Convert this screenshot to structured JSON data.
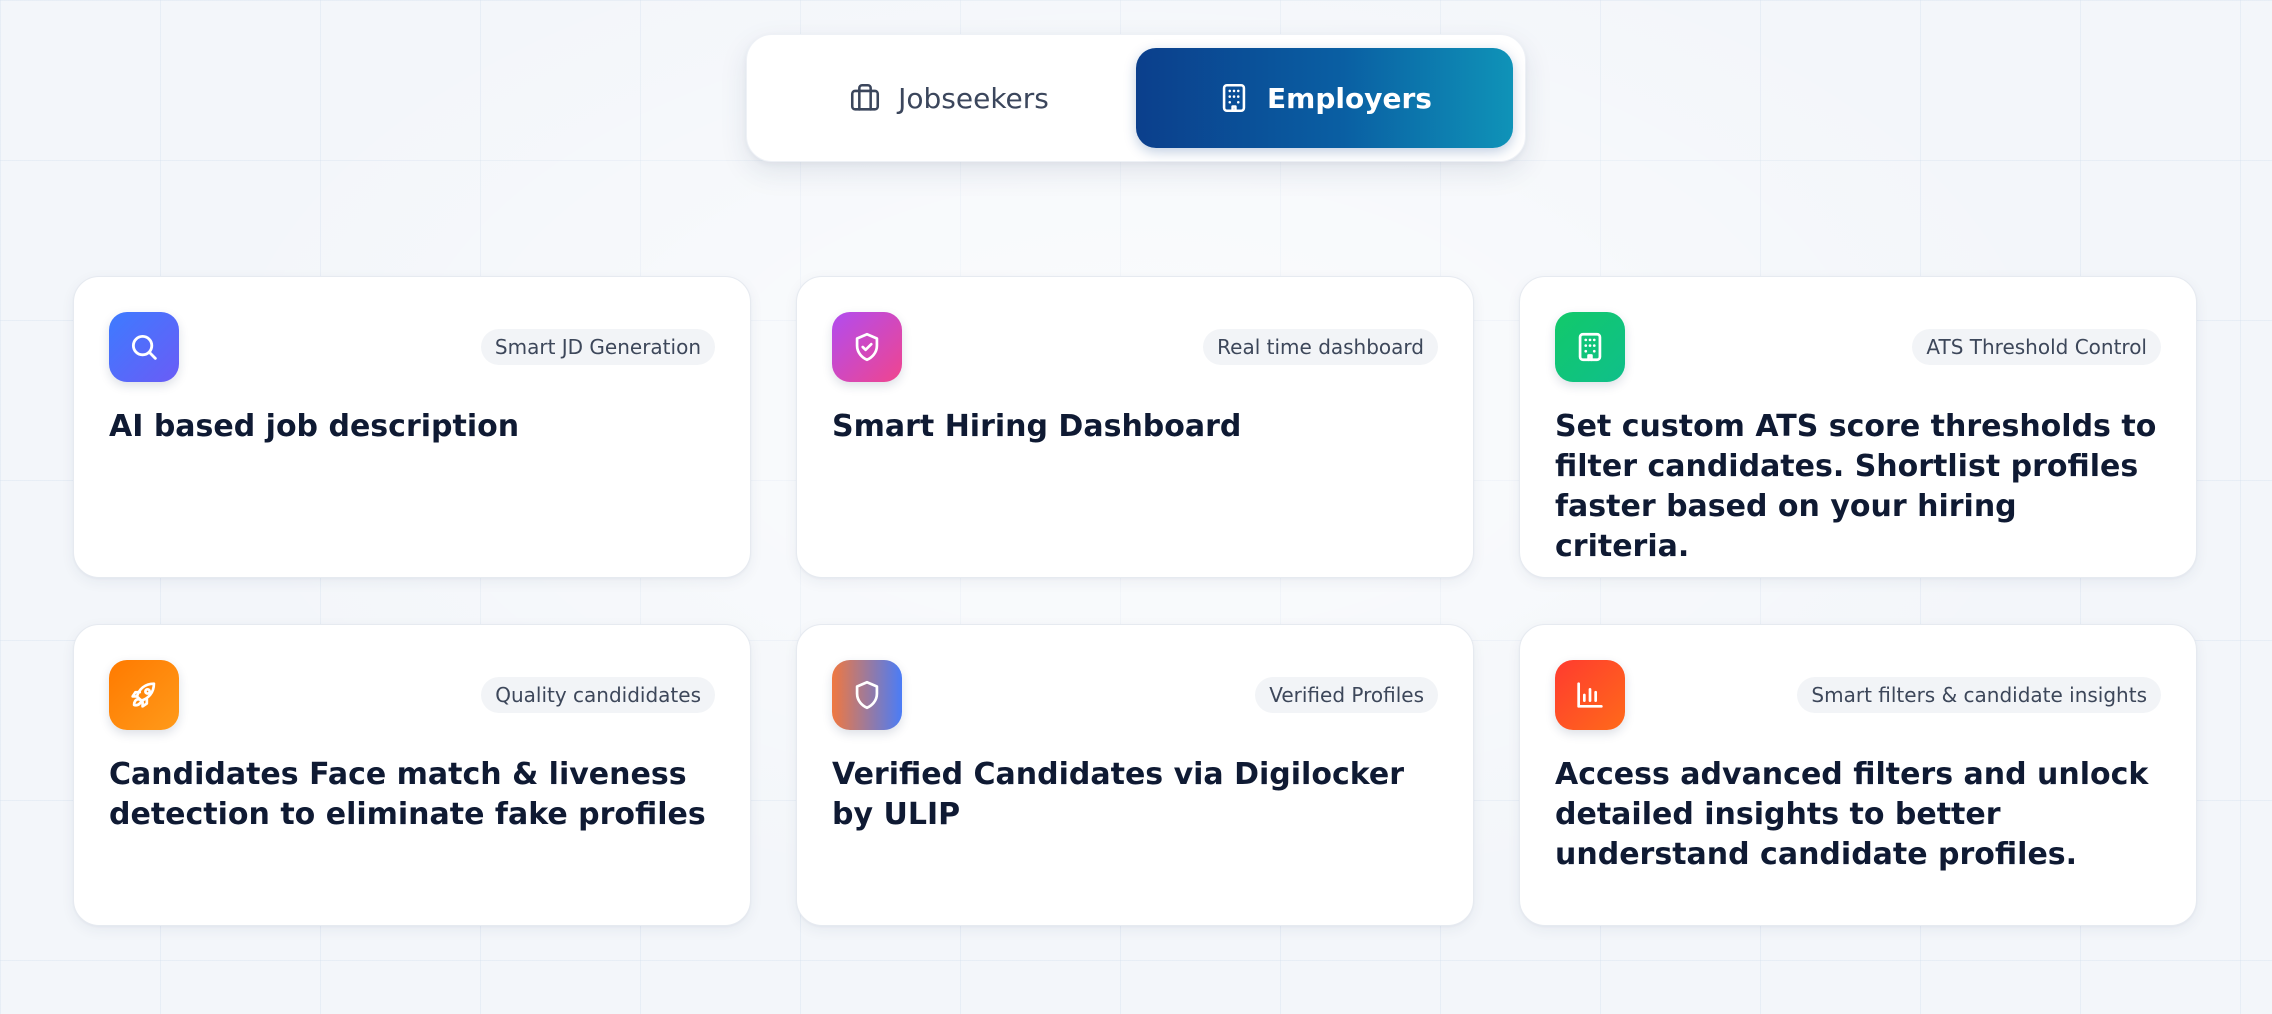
{
  "toggle": {
    "jobseekers_label": "Jobseekers",
    "jobseekers_icon": "briefcase-icon",
    "employers_label": "Employers",
    "employers_icon": "building-icon",
    "active": "Employers",
    "active_gradient": [
      "#0b3f8c",
      "#0f93b8"
    ]
  },
  "cards": [
    {
      "badge": "Smart JD Generation",
      "text": "AI based job description",
      "icon": "search-icon",
      "icon_gradient": [
        "#3d7bff",
        "#6a5cf6"
      ]
    },
    {
      "badge": "Real time dashboard",
      "text": "Smart Hiring Dashboard",
      "icon": "shield-check-icon",
      "icon_gradient": [
        "#b14cf0",
        "#f0458e"
      ]
    },
    {
      "badge": "ATS Threshold Control",
      "text": "Set custom ATS score thresholds to filter candidates. Shortlist profiles faster based on your hiring criteria.",
      "icon": "building-icon",
      "icon_gradient": [
        "#12c96a",
        "#0fbf8a"
      ]
    },
    {
      "badge": "Quality candididates",
      "text": "Candidates Face match & liveness detection to eliminate fake profiles",
      "icon": "rocket-icon",
      "icon_gradient": [
        "#ff7a00",
        "#ff9a1a"
      ]
    },
    {
      "badge": "Verified Profiles",
      "text": "Verified Candidates via Digilocker by ULIP",
      "icon": "shield-icon",
      "icon_gradient": [
        "#f07840",
        "#4a7cf7"
      ]
    },
    {
      "badge": "Smart filters & candidate insights",
      "text": "Access advanced filters and unlock detailed insights to better understand candidate profiles.",
      "icon": "bar-chart-icon",
      "icon_gradient": [
        "#ff3b2f",
        "#ff6a1a"
      ]
    }
  ]
}
